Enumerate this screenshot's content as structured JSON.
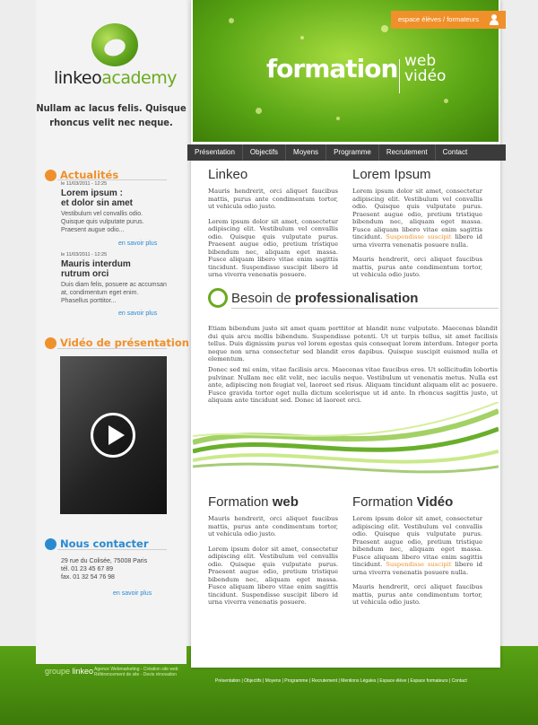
{
  "brand": {
    "logo_a": "linkeo",
    "logo_b": "academy",
    "tagline_1": "Nullam ac lacus felis. Quisque",
    "tagline_2": "rhoncus velit nec neque."
  },
  "banner": {
    "title": "formation",
    "sub1": "web",
    "sub2": "vidéo",
    "espace": "espace élèves  /  formateurs"
  },
  "nav": [
    "Présentation",
    "Objectifs",
    "Moyens",
    "Programme",
    "Recrutement",
    "Contact"
  ],
  "sidebar": {
    "actualites_title": "Actualités",
    "news": [
      {
        "date": "le 11/03/2011 - 12:25",
        "title_1": "Lorem ipsum :",
        "title_2": "et dolor sin amet",
        "text": "Vestibulum vel convallis odio. Quisque quis vulputate purus. Praesent augue odio...",
        "more": "en savoir plus"
      },
      {
        "date": "le 11/03/2011 - 12:25",
        "title_1": "Mauris interdum",
        "title_2": "rutrum orci",
        "text": "Duis diam felis, posuere ac accumsan at, condimentum eget enim. Phasellus porttitor...",
        "more": "en savoir plus"
      }
    ],
    "video_title": "Vidéo de présentation",
    "contact_title": "Nous contacter",
    "contact_addr": "29 rue du Colisée, 75008 Paris",
    "contact_tel": "tél. 01 23 45 67 89",
    "contact_fax": "fax. 01 32 54 76 98",
    "contact_more": "en savoir plus"
  },
  "content": {
    "linkeo_title": "Linkeo",
    "linkeo_p1": "Mauris hendrerit, orci aliquet faucibus mattis, purus ante condimentum tortor, ut vehicula odio justo.",
    "linkeo_p2": "Lorem ipsum dolor sit amet, consectetur adipiscing elit. Vestibulum vel convallis odio. Quisque quis vulputate purus. Praesent augue odio, pretium tristique bibendum nec, aliquam eget massa. Fusce aliquam libero vitae enim sagittis tincidunt. Suspendisse suscipit libero id urna viverra venenatis posuere.",
    "lorem_title": "Lorem Ipsum",
    "lorem_p1a": "Lorem ipsum dolor sit amet, consectetur adipiscing elit. Vestibulum vel convallis odio. Quisque quis vulputate purus. Praesent augue odio, pretium tristique bibendum nec, aliquam eget massa. Fusce aliquam libero vitae enim sagittis tincidunt.",
    "lorem_link": "Suspendisse suscipit",
    "lorem_p1b": "libero id urna viverra venenatis posuere nulla.",
    "lorem_p2": "Mauris hendrerit, orci aliquet faucibus mattis, purus ante condimentum tortor, ut vehicula odio justo.",
    "besoin_a": "Besoin de ",
    "besoin_b": "professionalisation",
    "besoin_p1": "Etiam bibendum justo sit amet quam porttitor at blandit nunc vulputate. Maecenas blandit dui quis arcu mollis bibendum. Suspendisse potenti. Ut ut turpis tellus, sit amet facilisis tellus. Duis dignissim purus vel lorem egestas quis consequat lorem interdum. Integer porta neque non urna consectetur sed blandit eros dapibus. Quisque suscipit euismod nulla et elementum.",
    "besoin_p2": "Donec sed mi enim, vitae facilisis arcu. Maecenas vitae faucibus eros. Ut sollicitudin lobortis pulvinar. Nullam nec elit velit, nec iaculis neque. Vestibulum ut venenatis metus. Nulla est ante, adipiscing non feugiat vel, laoreet sed risus. Aliquam tincidunt aliquam elit ac posuere. Fusce gravida tortor eget nulla dictum scelerisque ut id ante. In rhoncus sagittis justo, ut aliquam ante tincidunt sed. Donec id laoreet orci.",
    "fweb_a": "Formation ",
    "fweb_b": "web",
    "fweb_p1": "Mauris hendrerit, orci aliquet faucibus mattis, purus ante condimentum tortor, ut vehicula odio justo.",
    "fweb_p2": "Lorem ipsum dolor sit amet, consectetur adipiscing elit. Vestibulum vel convallis odio. Quisque quis vulputate purus. Praesent augue odio, pretium tristique bibendum nec, aliquam eget massa. Fusce aliquam libero vitae enim sagittis tincidunt. Suspendisse suscipit libero id urna viverra venenatis posuere.",
    "fvid_a": "Formation ",
    "fvid_b": "Vidéo",
    "fvid_p1a": "Lorem ipsum dolor sit amet, consectetur adipiscing elit. Vestibulum vel convallis odio. Quisque quis vulputate purus. Praesent augue odio, pretium tristique bibendum nec, aliquam eget massa. Fusce aliquam libero vitae enim sagittis tincidunt.",
    "fvid_link": "Suspendisse suscipit",
    "fvid_p1b": "libero id urna viverra venenatis posuere nulla.",
    "fvid_p2": "Mauris hendrerit, orci aliquet faucibus mattis, purus ante condimentum tortor, ut vehicula odio justo."
  },
  "footer": {
    "brand_a": "groupe ",
    "brand_b": "linkeo",
    "sub1": "Agence Webmarketing - Création site web",
    "sub2": "Référencement de site - Devis rénovation",
    "links": "Présentation  |  Objectifs  |  Moyens  |  Programme  |  Recrutement  |  Mentions Légales  |  Espace élève  |  Espace formateurs  |  Contact"
  },
  "colors": {
    "accent_green": "#6aaa1e",
    "accent_orange": "#f0902a",
    "accent_blue": "#2a8ad0"
  }
}
